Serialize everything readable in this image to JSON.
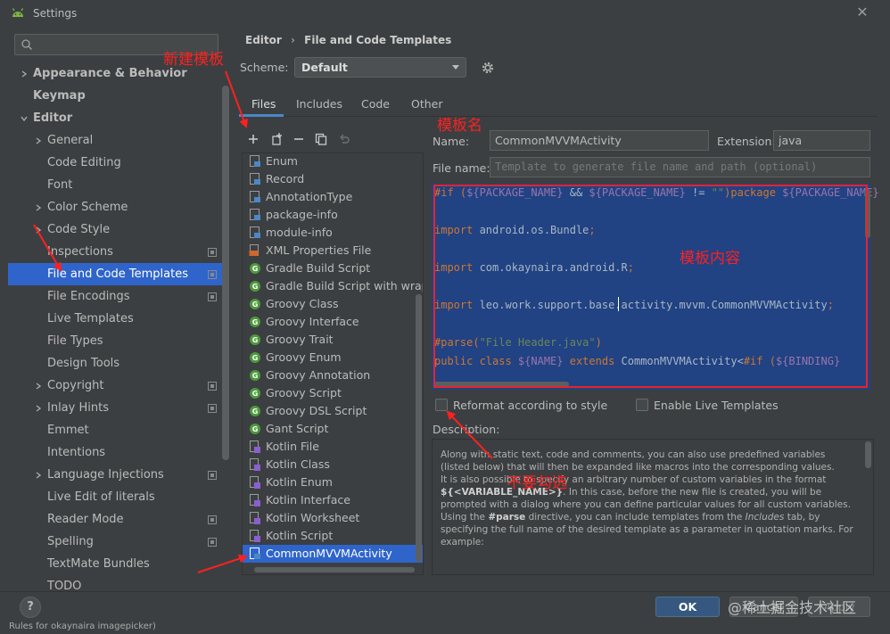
{
  "window": {
    "title": "Settings"
  },
  "search": {
    "placeholder": ""
  },
  "tree": [
    {
      "label": "Appearance & Behavior",
      "indent": 0,
      "arrow": "right",
      "bold": true,
      "badge": false
    },
    {
      "label": "Keymap",
      "indent": 0,
      "arrow": "",
      "bold": true,
      "badge": false
    },
    {
      "label": "Editor",
      "indent": 0,
      "arrow": "down",
      "bold": true,
      "badge": false
    },
    {
      "label": "General",
      "indent": 1,
      "arrow": "right",
      "bold": false,
      "badge": false
    },
    {
      "label": "Code Editing",
      "indent": 1,
      "arrow": "",
      "bold": false,
      "badge": false
    },
    {
      "label": "Font",
      "indent": 1,
      "arrow": "",
      "bold": false,
      "badge": false
    },
    {
      "label": "Color Scheme",
      "indent": 1,
      "arrow": "right",
      "bold": false,
      "badge": false
    },
    {
      "label": "Code Style",
      "indent": 1,
      "arrow": "right",
      "bold": false,
      "badge": false
    },
    {
      "label": "Inspections",
      "indent": 1,
      "arrow": "",
      "bold": false,
      "badge": true
    },
    {
      "label": "File and Code Templates",
      "indent": 1,
      "arrow": "",
      "bold": false,
      "badge": true,
      "selected": true
    },
    {
      "label": "File Encodings",
      "indent": 1,
      "arrow": "",
      "bold": false,
      "badge": true
    },
    {
      "label": "Live Templates",
      "indent": 1,
      "arrow": "",
      "bold": false,
      "badge": false
    },
    {
      "label": "File Types",
      "indent": 1,
      "arrow": "",
      "bold": false,
      "badge": false
    },
    {
      "label": "Design Tools",
      "indent": 1,
      "arrow": "",
      "bold": false,
      "badge": false
    },
    {
      "label": "Copyright",
      "indent": 1,
      "arrow": "right",
      "bold": false,
      "badge": true
    },
    {
      "label": "Inlay Hints",
      "indent": 1,
      "arrow": "right",
      "bold": false,
      "badge": true
    },
    {
      "label": "Emmet",
      "indent": 1,
      "arrow": "",
      "bold": false,
      "badge": false
    },
    {
      "label": "Intentions",
      "indent": 1,
      "arrow": "",
      "bold": false,
      "badge": false
    },
    {
      "label": "Language Injections",
      "indent": 1,
      "arrow": "right",
      "bold": false,
      "badge": true
    },
    {
      "label": "Live Edit of literals",
      "indent": 1,
      "arrow": "",
      "bold": false,
      "badge": false
    },
    {
      "label": "Reader Mode",
      "indent": 1,
      "arrow": "",
      "bold": false,
      "badge": true
    },
    {
      "label": "Spelling",
      "indent": 1,
      "arrow": "",
      "bold": false,
      "badge": true
    },
    {
      "label": "TextMate Bundles",
      "indent": 1,
      "arrow": "",
      "bold": false,
      "badge": false
    },
    {
      "label": "TODO",
      "indent": 1,
      "arrow": "",
      "bold": false,
      "badge": false
    }
  ],
  "breadcrumb": {
    "parent": "Editor",
    "sep": "›",
    "current": "File and Code Templates"
  },
  "scheme": {
    "label": "Scheme:",
    "value": "Default"
  },
  "tabs": [
    "Files",
    "Includes",
    "Code",
    "Other"
  ],
  "templates": [
    {
      "label": "Enum",
      "icon": "java"
    },
    {
      "label": "Record",
      "icon": "java"
    },
    {
      "label": "AnnotationType",
      "icon": "java"
    },
    {
      "label": "package-info",
      "icon": "java"
    },
    {
      "label": "module-info",
      "icon": "java"
    },
    {
      "label": "XML Properties File",
      "icon": "xml"
    },
    {
      "label": "Gradle Build Script",
      "icon": "groovy"
    },
    {
      "label": "Gradle Build Script with wrapper",
      "icon": "groovy"
    },
    {
      "label": "Groovy Class",
      "icon": "groovy"
    },
    {
      "label": "Groovy Interface",
      "icon": "groovy"
    },
    {
      "label": "Groovy Trait",
      "icon": "groovy"
    },
    {
      "label": "Groovy Enum",
      "icon": "groovy"
    },
    {
      "label": "Groovy Annotation",
      "icon": "groovy"
    },
    {
      "label": "Groovy Script",
      "icon": "groovy"
    },
    {
      "label": "Groovy DSL Script",
      "icon": "groovy"
    },
    {
      "label": "Gant Script",
      "icon": "groovy"
    },
    {
      "label": "Kotlin File",
      "icon": "kotlin"
    },
    {
      "label": "Kotlin Class",
      "icon": "kotlin"
    },
    {
      "label": "Kotlin Enum",
      "icon": "kotlin"
    },
    {
      "label": "Kotlin Interface",
      "icon": "kotlin"
    },
    {
      "label": "Kotlin Worksheet",
      "icon": "kotlin"
    },
    {
      "label": "Kotlin Script",
      "icon": "kotlin"
    },
    {
      "label": "CommonMVVMActivity",
      "icon": "java",
      "selected": true
    }
  ],
  "form": {
    "name_label": "Name:",
    "name_value": "CommonMVVMActivity",
    "extension_label": "Extension:",
    "extension_value": "java",
    "filename_label": "File name:",
    "filename_placeholder": "Template to generate file name and path (optional)"
  },
  "code": {
    "line1": {
      "a": "#if (",
      "b": "${PACKAGE_NAME}",
      "c": " && ",
      "d": "${PACKAGE_NAME}",
      "e": " != ",
      "f": "\"\"",
      "g": ")package ",
      "h": "${PACKAGE_NAME}"
    },
    "line2": {
      "kw": "import",
      "rest": " android.os.Bundle",
      "end": ";"
    },
    "line3": {
      "kw": "import",
      "rest": " com.okaynaira.android.R",
      "end": ";"
    },
    "line4": {
      "kw": "import",
      "rest": " leo.work.support.base.activity.mvvm.CommonMVVMActivity",
      "end": ";"
    },
    "line5": {
      "a": "#parse(",
      "b": "\"File Header.java\"",
      "c": ")"
    },
    "line6": {
      "a": "public class ",
      "b": "${NAME}",
      "c": " extends ",
      "d": "CommonMVVMActivity<",
      "e": "#if (",
      "f": "${BINDING}"
    }
  },
  "options": {
    "reformat": "Reformat according to style",
    "live": "Enable Live Templates"
  },
  "description": {
    "label": "Description:",
    "p1": "Along with static text, code and comments, you can also use predefined variables (listed below) that will then be expanded like macros into the corresponding values.",
    "p2a": "It is also possible to specify an arbitrary number of custom variables in the format ",
    "p2b": "${<VARIABLE_NAME>}",
    "p2c": ". In this case, before the new file is created, you will be prompted with a dialog where you can define particular values for all custom variables.",
    "p3a": "Using the ",
    "p3b": "#parse",
    "p3c": " directive, you can include templates from the ",
    "p3d": "Includes",
    "p3e": " tab, by specifying the full name of the desired template as a parameter in quotation marks. For example:"
  },
  "buttons": {
    "help": "?",
    "ok": "OK",
    "cancel": "Cancel",
    "apply": "Apply"
  },
  "annotations": {
    "new_template": "新建模板",
    "template_name": "模板名",
    "template_content": "模板内容",
    "do_not_check": "不要勾选"
  },
  "watermark": "@稀土掘金技术社区",
  "background_text": {
    "partial_bottom": "Rules for okaynaira imagepicker)"
  },
  "colors": {
    "accent": "#2f65ca",
    "annotation": "#e8242a",
    "ok_button": "#365880"
  }
}
